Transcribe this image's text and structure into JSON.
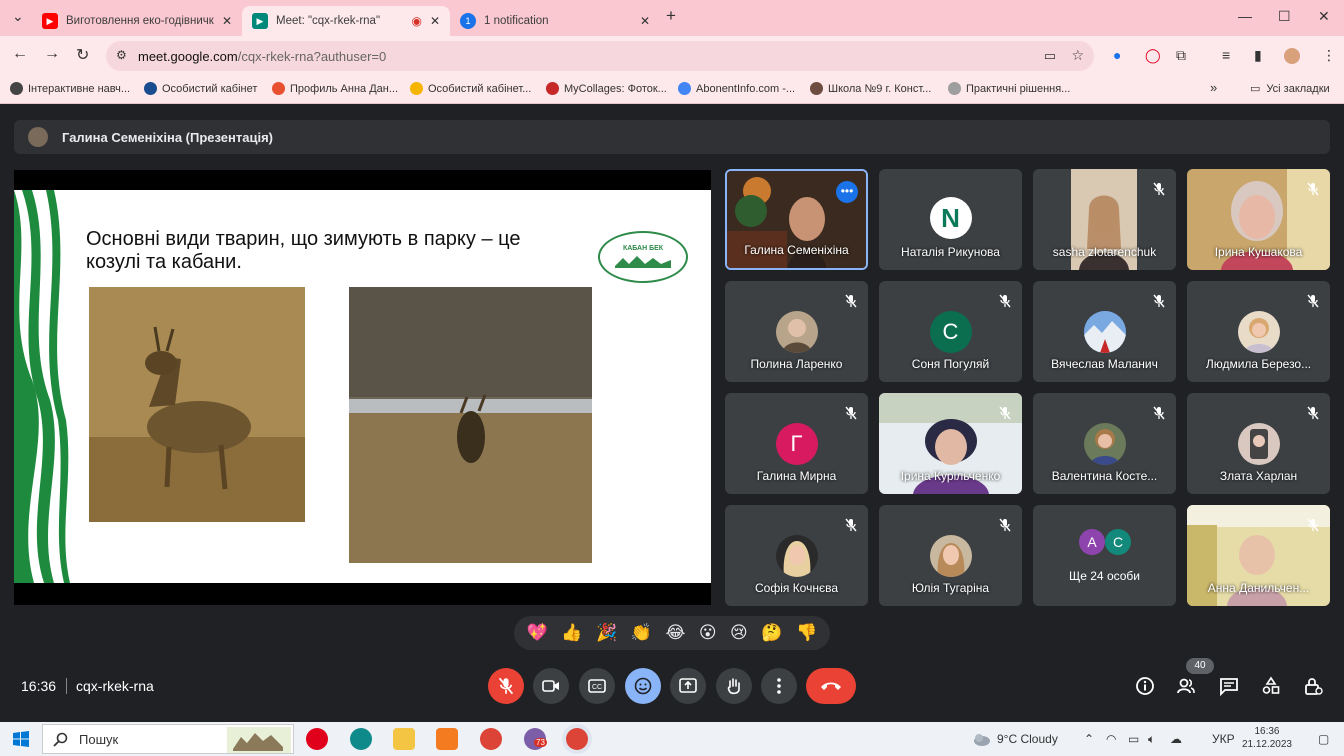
{
  "browser": {
    "tabs": [
      {
        "title": "Виготовлення еко-годівничкі",
        "favicon": "youtube-icon",
        "color": "#ff0000"
      },
      {
        "title": "Meet: \"cqx-rkek-rna\"",
        "favicon": "meet-icon",
        "color": "#00897b",
        "active": true
      },
      {
        "title": "1 notification",
        "favicon": "notification-icon",
        "color": "#1a73e8",
        "badge": "1"
      }
    ],
    "url_host": "meet.google.com",
    "url_path": "/cqx-rkek-rna?authuser=0",
    "bookmarks": [
      "Інтерактивне навч...",
      "Особистий кабінет",
      "Профиль Анна Дан...",
      "Особистий кабінет...",
      "MyCollages: Фоток...",
      "AbonentInfo.com -...",
      "Школа №9 г. Конст...",
      "Практичні рішення..."
    ],
    "all_bookmarks": "Усі закладки",
    "more_bookmarks": "»"
  },
  "meet": {
    "presenter_label": "Галина Семеніхіна (Презентація)",
    "slide": {
      "title": "Основні види тварин, що зимують в парку – це козулі та кабани.",
      "logo_text": "КАБАН БЕК"
    },
    "participants": [
      {
        "name": "Галина Семеніхіна",
        "kind": "video",
        "active": true,
        "muted": false
      },
      {
        "name": "Наталія Рикунова",
        "kind": "logo",
        "initial": "N",
        "muted": false
      },
      {
        "name": "sasha zlotarenchuk",
        "kind": "video",
        "muted": true
      },
      {
        "name": "Ірина Кушакова",
        "kind": "video",
        "muted": true
      },
      {
        "name": "Полина Ларенко",
        "kind": "photo",
        "muted": true
      },
      {
        "name": "Соня Погуляй",
        "kind": "initial",
        "initial": "С",
        "color": "#0b6e4f",
        "muted": true
      },
      {
        "name": "Вячеслав Маланич",
        "kind": "photo",
        "muted": true
      },
      {
        "name": "Людмила Березо...",
        "kind": "photo",
        "muted": true
      },
      {
        "name": "Галина Мирна",
        "kind": "initial",
        "initial": "Г",
        "color": "#d81b60",
        "muted": true
      },
      {
        "name": "Ірина Курільченко",
        "kind": "video",
        "muted": true
      },
      {
        "name": "Валентина Косте...",
        "kind": "photo",
        "muted": true
      },
      {
        "name": "Злата Харлан",
        "kind": "photo",
        "muted": true
      },
      {
        "name": "Софія Кочнєва",
        "kind": "photo",
        "muted": true
      },
      {
        "name": "Юлія Тугаріна",
        "kind": "photo",
        "muted": true
      },
      {
        "name": "Ще 24 особи",
        "kind": "more",
        "initials": [
          "А",
          "С"
        ]
      },
      {
        "name": "Анна Данильчен...",
        "kind": "video",
        "muted": true
      }
    ],
    "reactions": [
      "💖",
      "👍",
      "🎉",
      "👏",
      "😂",
      "😮",
      "😢",
      "🤔",
      "👎"
    ],
    "time": "16:36",
    "meeting_code": "cqx-rkek-rna",
    "participant_count": "40"
  },
  "taskbar": {
    "search_label": "Пошук",
    "weather": "9°C Cloudy",
    "language": "УКР",
    "time": "16:36",
    "date": "21.12.2023",
    "app_badge": "73"
  }
}
